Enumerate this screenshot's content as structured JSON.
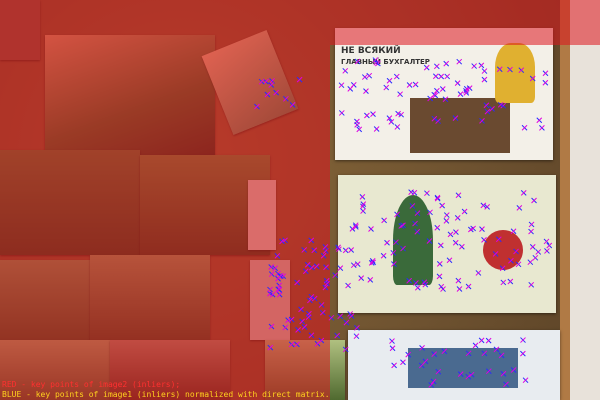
{
  "image": {
    "description_colors": {
      "overlay": "#dc141e",
      "keypoint_blue": "#2a2aff",
      "keypoint_magenta": "#e000e0",
      "legend_red": "#ff3030",
      "legend_yellow": "#ffd21e"
    }
  },
  "legend": {
    "line1": "RED - key points of image2 (inliers);",
    "line2": "BLUE - key points of image1 (inliers) normalized with direct matrix."
  },
  "card1": {
    "text_line1": "НЕ ВСЯКИЙ",
    "text_line2": "ГЛАВНЫЙ БУХГАЛТЕР"
  }
}
